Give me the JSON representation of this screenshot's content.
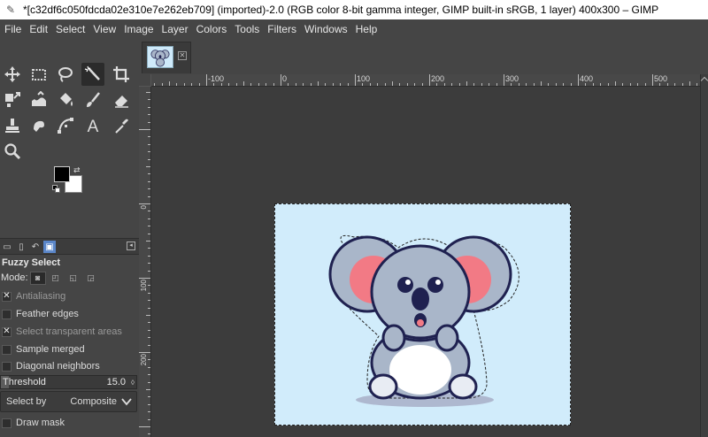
{
  "window": {
    "title": "*[c32df6c050fdcda02e310e7e262eb709] (imported)-2.0 (RGB color 8-bit gamma integer, GIMP built-in sRGB, 1 layer) 400x300 – GIMP"
  },
  "menubar": {
    "items": [
      "File",
      "Edit",
      "Select",
      "View",
      "Image",
      "Layer",
      "Colors",
      "Tools",
      "Filters",
      "Windows",
      "Help"
    ]
  },
  "toolbox": {
    "tools": [
      {
        "name": "move-tool-icon"
      },
      {
        "name": "rect-select-icon"
      },
      {
        "name": "free-select-icon"
      },
      {
        "name": "fuzzy-select-icon",
        "active": true
      },
      {
        "name": "crop-icon"
      },
      {
        "name": "transform-icon"
      },
      {
        "name": "warp-icon"
      },
      {
        "name": "bucket-fill-icon"
      },
      {
        "name": "paintbrush-icon"
      },
      {
        "name": "eraser-icon"
      },
      {
        "name": "clone-icon"
      },
      {
        "name": "smudge-icon"
      },
      {
        "name": "paths-icon"
      },
      {
        "name": "text-icon"
      },
      {
        "name": "color-picker-icon"
      },
      {
        "name": "zoom-icon"
      }
    ],
    "fg_color": "#000000",
    "bg_color": "#ffffff"
  },
  "tool_options": {
    "title": "Fuzzy Select",
    "mode_label": "Mode:",
    "options": [
      {
        "label": "Antialiasing",
        "checked": true,
        "dim": true
      },
      {
        "label": "Feather edges",
        "checked": false,
        "dim": false
      },
      {
        "label": "Select transparent areas",
        "checked": true,
        "dim": true
      },
      {
        "label": "Sample merged",
        "checked": false,
        "dim": false
      },
      {
        "label": "Diagonal neighbors",
        "checked": false,
        "dim": false
      }
    ],
    "threshold": {
      "label": "Threshold",
      "value": "15.0",
      "fraction": 0.06
    },
    "select_by": {
      "label": "Select by",
      "value": "Composite"
    },
    "draw_mask": {
      "label": "Draw mask",
      "checked": false
    }
  },
  "rulers": {
    "h_labels": [
      "-100",
      "0",
      "100",
      "200",
      "300",
      "400",
      "500"
    ],
    "v_labels": [
      "0",
      "100",
      "200"
    ]
  },
  "colors": {
    "canvas_bg": "#d1ecfb",
    "koala_fur": "#a9b6c9",
    "ear_inner": "#f27a85",
    "outline": "#1f2150"
  }
}
